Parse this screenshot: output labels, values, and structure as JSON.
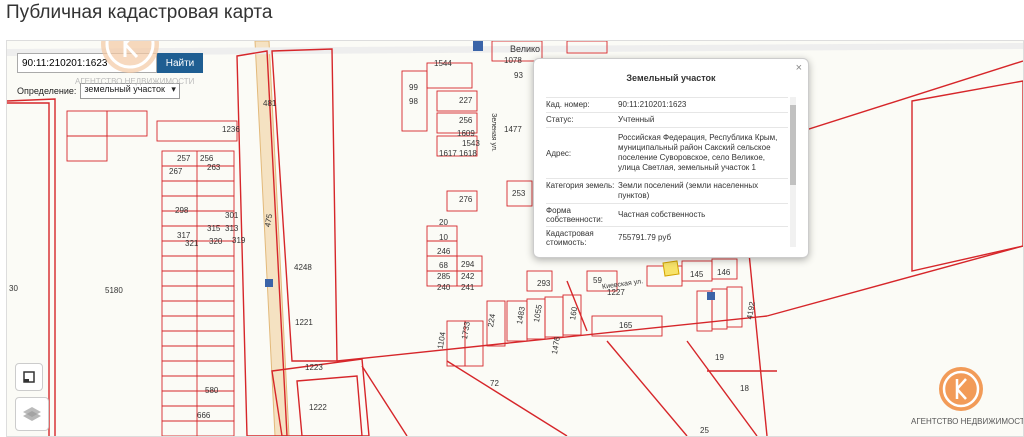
{
  "page": {
    "title": "Публичная кадастровая карта"
  },
  "search": {
    "value": "90:11:210201:1623",
    "button": "Найти"
  },
  "definition": {
    "label": "Определение:",
    "value": "земельный участок"
  },
  "watermark": "АГЕНТСТВО НЕДВИЖИМОСТИ",
  "popup": {
    "title": "Земельный участок",
    "close": "×",
    "rows": [
      {
        "key": "Кад. номер:",
        "value": "90:11:210201:1623"
      },
      {
        "key": "Статус:",
        "value": "Учтенный"
      },
      {
        "key": "Адрес:",
        "value": "Российская Федерация, Республика Крым, муниципальный район Сакский сельское поселение Суворовское, село Великое, улица Светлая, земельный участок 1"
      },
      {
        "key": "Категория земель:",
        "value": "Земли поселений (земли населенных пунктов)"
      },
      {
        "key": "Форма собственности:",
        "value": "Частная собственность"
      },
      {
        "key": "Кадастровая стоимость:",
        "value": "755791.79 руб"
      }
    ]
  },
  "map_labels": [
    "1544",
    "1078",
    "93",
    "99",
    "98",
    "227",
    "256",
    "1609",
    "1543",
    "1617",
    "1618",
    "1477",
    "1236",
    "257",
    "256",
    "267",
    "263",
    "298",
    "301",
    "317",
    "315",
    "313",
    "321",
    "320",
    "319",
    "481",
    "475",
    "5180",
    "4248",
    "1221",
    "1223",
    "1222",
    "276",
    "20",
    "10",
    "246",
    "68",
    "294",
    "285",
    "242",
    "240",
    "241",
    "253",
    "293",
    "59",
    "1227",
    "145",
    "146",
    "165",
    "72",
    "19",
    "18",
    "580",
    "666",
    "25",
    "4192",
    "1104",
    "1733",
    "224",
    "1483",
    "1055",
    "1476",
    "160",
    "Велико",
    "Киевская ул.",
    "Зеленая ул.",
    "30",
    "Велико"
  ]
}
